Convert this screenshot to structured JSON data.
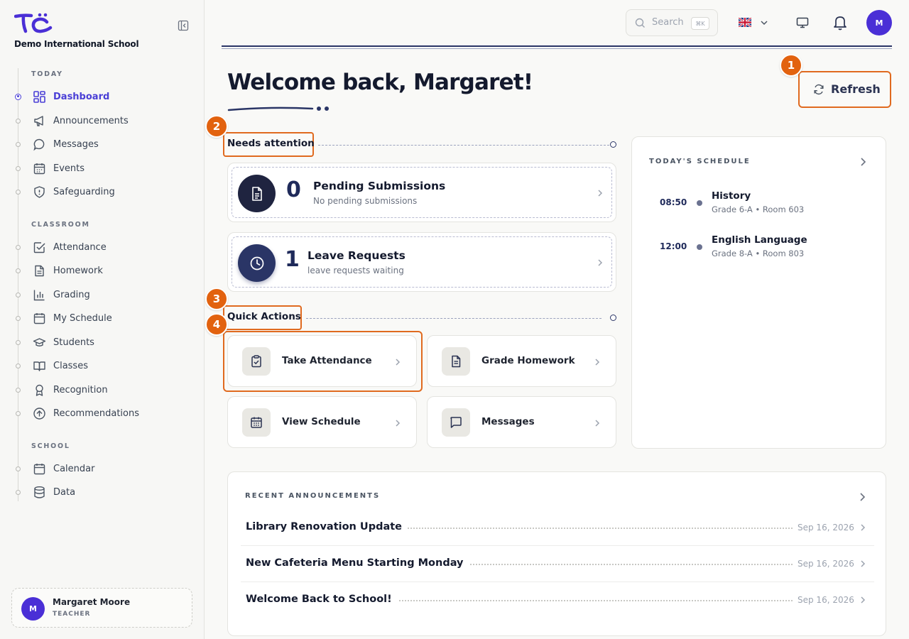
{
  "school": {
    "name": "Demo International School"
  },
  "nav": {
    "sections": [
      {
        "label": "TODAY"
      },
      {
        "label": "CLASSROOM"
      },
      {
        "label": "SCHOOL"
      }
    ],
    "items": [
      {
        "label": "Dashboard",
        "icon": "grid-icon"
      },
      {
        "label": "Announcements",
        "icon": "megaphone-icon"
      },
      {
        "label": "Messages",
        "icon": "chat-bubble-icon"
      },
      {
        "label": "Events",
        "icon": "calendar-icon"
      },
      {
        "label": "Safeguarding",
        "icon": "shield-icon"
      },
      {
        "label": "Attendance",
        "icon": "checkbox-icon"
      },
      {
        "label": "Homework",
        "icon": "document-icon"
      },
      {
        "label": "Grading",
        "icon": "bar-chart-icon"
      },
      {
        "label": "My Schedule",
        "icon": "calendar-icon"
      },
      {
        "label": "Students",
        "icon": "graduation-cap-icon"
      },
      {
        "label": "Classes",
        "icon": "book-icon"
      },
      {
        "label": "Recognition",
        "icon": "award-icon"
      },
      {
        "label": "Recommendations",
        "icon": "arrow-up-circle-icon"
      },
      {
        "label": "Calendar",
        "icon": "calendar-icon"
      },
      {
        "label": "Data",
        "icon": "database-icon"
      }
    ]
  },
  "user": {
    "name": "Margaret Moore",
    "role": "TEACHER",
    "initial": "M"
  },
  "topbar": {
    "search_placeholder": "Search",
    "search_shortcut": "⌘K"
  },
  "header": {
    "title": "Welcome back, Margaret!",
    "refresh_label": "Refresh"
  },
  "markers": [
    "1",
    "2",
    "3",
    "4"
  ],
  "attention": {
    "title": "Needs attention",
    "cards": [
      {
        "count": "0",
        "title": "Pending Submissions",
        "subtitle": "No pending submissions"
      },
      {
        "count": "1",
        "title": "Leave Requests",
        "subtitle": "leave requests waiting"
      }
    ]
  },
  "quick_actions": {
    "title": "Quick Actions",
    "items": [
      {
        "label": "Take Attendance"
      },
      {
        "label": "Grade Homework"
      },
      {
        "label": "View Schedule"
      },
      {
        "label": "Messages"
      }
    ]
  },
  "schedule": {
    "title": "TODAY'S SCHEDULE",
    "items": [
      {
        "time": "08:50",
        "subject": "History",
        "detail": "Grade 6-A • Room 603"
      },
      {
        "time": "12:00",
        "subject": "English Language",
        "detail": "Grade 8-A • Room 803"
      }
    ]
  },
  "announcements": {
    "title": "RECENT ANNOUNCEMENTS",
    "items": [
      {
        "title": "Library Renovation Update",
        "date": "Sep 16, 2026"
      },
      {
        "title": "New Cafeteria Menu Starting Monday",
        "date": "Sep 16, 2026"
      },
      {
        "title": "Welcome Back to School!",
        "date": "Sep 16, 2026"
      }
    ]
  },
  "colors": {
    "brand": "#4a2fd6",
    "accent": "#e2620f",
    "navy": "#2a3566"
  }
}
